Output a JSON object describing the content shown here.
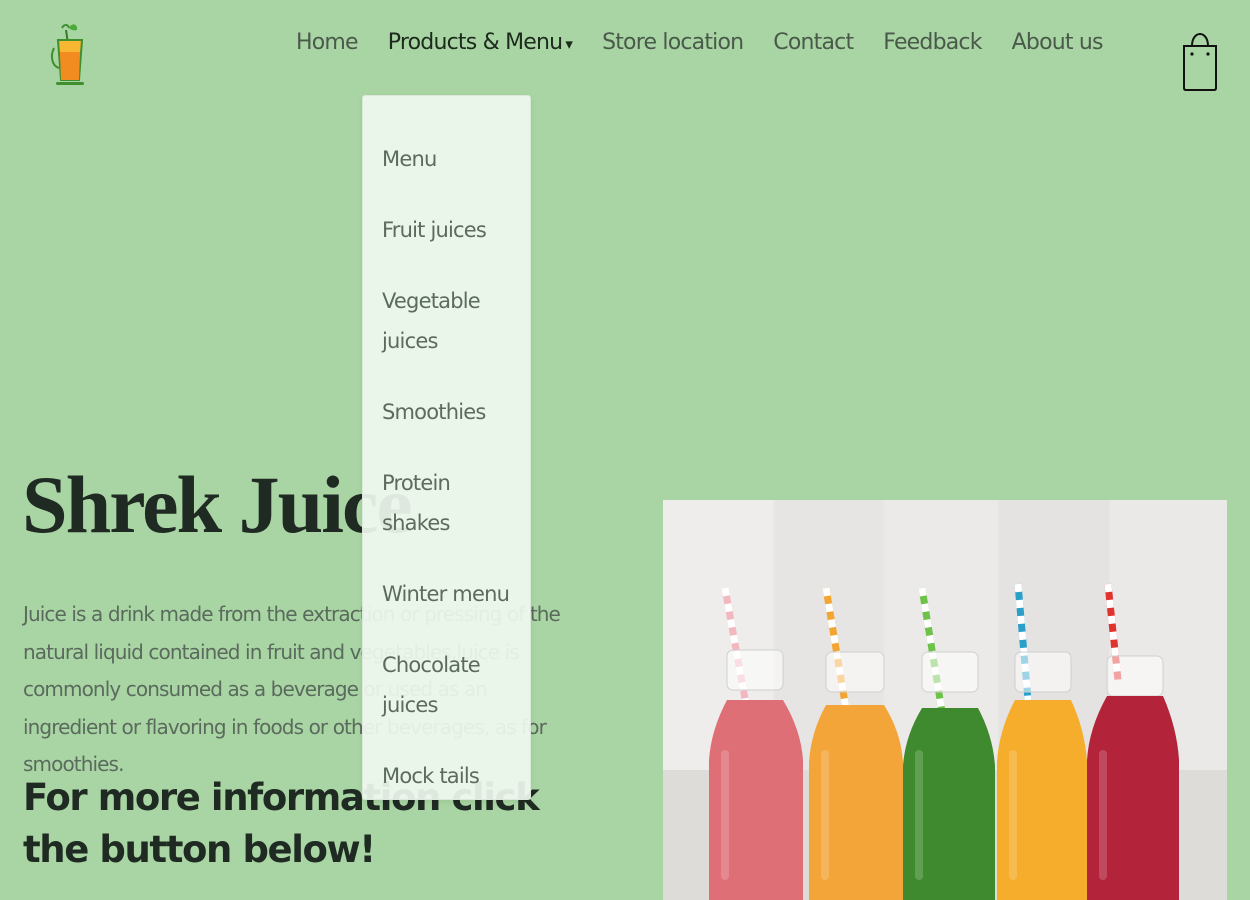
{
  "nav": {
    "items": [
      {
        "label": "Home"
      },
      {
        "label": "Products & Menu",
        "caret": "▾"
      },
      {
        "label": "Store location"
      },
      {
        "label": "Contact"
      },
      {
        "label": "Feedback"
      },
      {
        "label": "About us"
      }
    ]
  },
  "dropdown": {
    "items": [
      {
        "label": "Menu"
      },
      {
        "label": "Fruit juices"
      },
      {
        "label": "Vegetable juices"
      },
      {
        "label": "Smoothies"
      },
      {
        "label": "Protein shakes"
      },
      {
        "label": "Winter menu"
      },
      {
        "label": "Chocolate juices"
      },
      {
        "label": "Mock tails"
      }
    ]
  },
  "hero": {
    "title": "Shrek Juice",
    "description": "Juice is a drink made from the extraction or pressing of the natural liquid contained in fruit and vegetables.Juice is commonly consumed as a beverage or used as an ingredient or flavoring in foods or other beverages, as for smoothies.",
    "cta_text": "For more information click the button below!"
  },
  "icons": {
    "logo": "juice-glass-logo",
    "cart": "shopping-bag-icon"
  },
  "colors": {
    "background": "#a9d5a4",
    "dropdown_bg": "#f0f9f0",
    "text_dark": "#1f2a22",
    "text_muted": "#5a6a5c"
  }
}
